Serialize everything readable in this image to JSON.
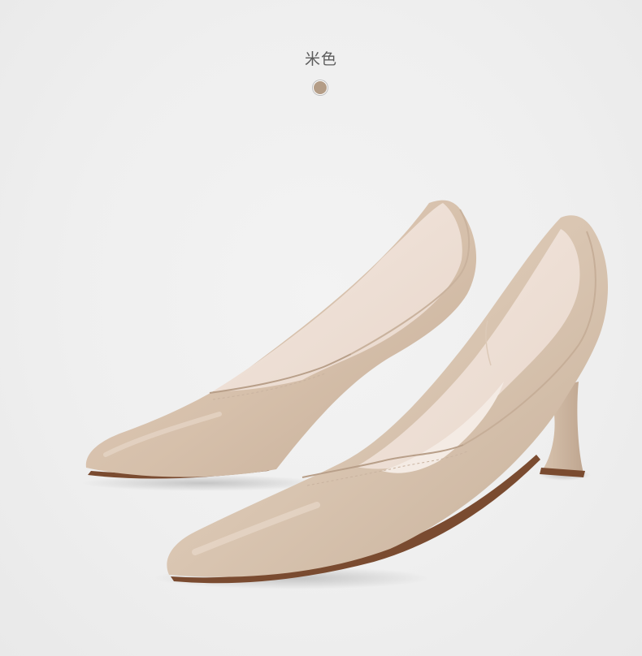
{
  "color_variant": {
    "label": "米色",
    "swatch_color": "#b49d87"
  },
  "product_image": {
    "alt": "米色",
    "leather_color": "#d8c4b1",
    "lining_color": "#f0e2d9",
    "sole_color": "#7a4b30"
  }
}
